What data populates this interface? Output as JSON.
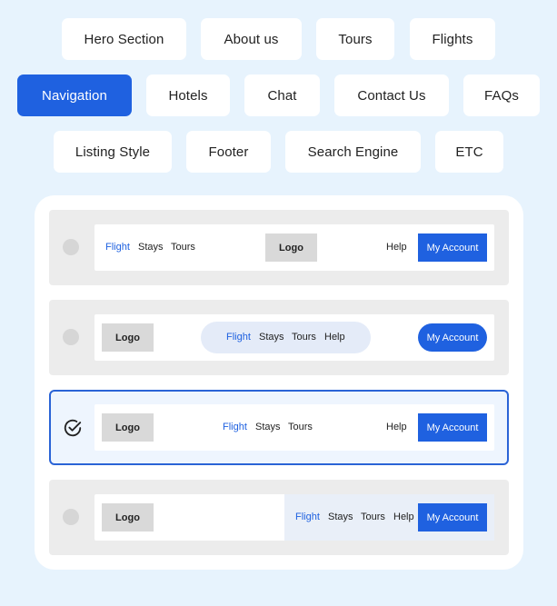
{
  "tags": {
    "row1": [
      "Hero Section",
      "About us",
      "Tours",
      "Flights"
    ],
    "row2": [
      "Navigation",
      "Hotels",
      "Chat",
      "Contact Us",
      "FAQs"
    ],
    "row3": [
      "Listing Style",
      "Footer",
      "Search Engine",
      "ETC"
    ],
    "active": "Navigation"
  },
  "colors": {
    "accent": "#1f61e0",
    "background": "#e7f3fd",
    "selected_border": "#2a63d6"
  },
  "nav_options": [
    {
      "id": "option-1",
      "selected": false,
      "logo": "Logo",
      "links": [
        "Flight",
        "Stays",
        "Tours"
      ],
      "help": "Help",
      "cta": "My Account"
    },
    {
      "id": "option-2",
      "selected": false,
      "logo": "Logo",
      "links": [
        "Flight",
        "Stays",
        "Tours",
        "Help"
      ],
      "cta": "My Account"
    },
    {
      "id": "option-3",
      "selected": true,
      "selected_icon": "check-circle-icon",
      "logo": "Logo",
      "links": [
        "Flight",
        "Stays",
        "Tours"
      ],
      "help": "Help",
      "cta": "My Account"
    },
    {
      "id": "option-4",
      "selected": false,
      "logo": "Logo",
      "links": [
        "Flight",
        "Stays",
        "Tours",
        "Help"
      ],
      "cta": "My Account"
    }
  ]
}
